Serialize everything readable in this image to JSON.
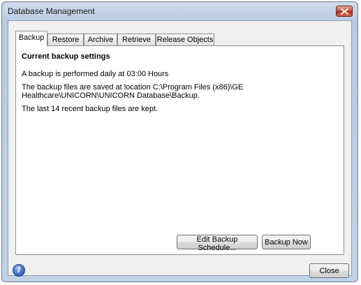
{
  "window": {
    "title": "Database Management"
  },
  "tabs": [
    {
      "label": "Backup",
      "active": true
    },
    {
      "label": "Restore",
      "active": false
    },
    {
      "label": "Archive",
      "active": false
    },
    {
      "label": "Retrieve",
      "active": false
    },
    {
      "label": "Release Objects",
      "active": false
    }
  ],
  "backup_panel": {
    "heading": "Current backup settings",
    "schedule_text": "A backup is performed daily at 03:00 Hours",
    "location_text": "The backup files are saved at location C:\\Program Files (x86)\\GE Healthcare\\UNICORN\\UNICORN Database\\Backup.",
    "retention_text": "The last 14 recent backup files are kept.",
    "edit_schedule_label": "Edit Backup Schedule...",
    "backup_now_label": "Backup Now"
  },
  "footer": {
    "help_icon": "question-mark-icon",
    "help_glyph": "?",
    "close_label": "Close"
  },
  "colors": {
    "titlebar": "#c2d3e8",
    "close_button": "#c7442d",
    "help_icon": "#2f5fbf"
  }
}
